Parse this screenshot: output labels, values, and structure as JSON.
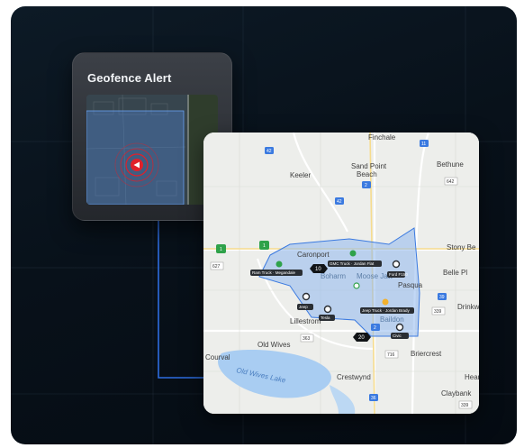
{
  "alert": {
    "title": "Geofence Alert"
  },
  "map": {
    "places": {
      "finchale": "Finchale",
      "bethune": "Bethune",
      "keeler": "Keeler",
      "sand_point_beach_1": "Sand Point",
      "sand_point_beach_2": "Beach",
      "caron": "Caronport",
      "boharm": "Boharm",
      "moose_jaw": "Moose Jaw",
      "pasqua": "Pasqua",
      "belle_plaine": "Belle Pl",
      "stony_beach": "Stony Be",
      "drinkwater": "Drinkw",
      "lillestrom": "Lillestrom",
      "baildon": "Baildon",
      "old_wives": "Old Wives",
      "courval": "Courval",
      "old_wives_lake": "Old Wives Lake",
      "briercrest": "Briercrest",
      "crestwynd": "Crestwynd",
      "hearne": "Hear",
      "claybank": "Claybank"
    },
    "shields": {
      "hwy42_top": "42",
      "hwy11": "11",
      "hwy2": "2",
      "hwy642": "642",
      "hwy42_mid": "42",
      "hwy1_left": "1",
      "hwy1_right": "1",
      "hwy627": "627",
      "hwy39": "39",
      "hwy339": "339",
      "hwy363": "363",
      "hwy716": "716",
      "hwy36": "36",
      "hwy2_center": "2",
      "hwy339_bottom": "339"
    },
    "vehicle_tags": [
      "Ram Truck · Megandale",
      "GMC Truck · Jordan Flat",
      "Ford F150",
      "Jeep",
      "Tesla",
      "Silverado",
      "Jeep Truck · Jordan Brady",
      "Civic"
    ],
    "cluster_counts": [
      "10",
      "20"
    ],
    "colors": {
      "geofence_fill": "#8fb8ee",
      "geofence_stroke": "#3b7ae0",
      "water": "#a9cdf2",
      "alert_red": "#e0202a",
      "connector": "#2d6de0"
    }
  }
}
